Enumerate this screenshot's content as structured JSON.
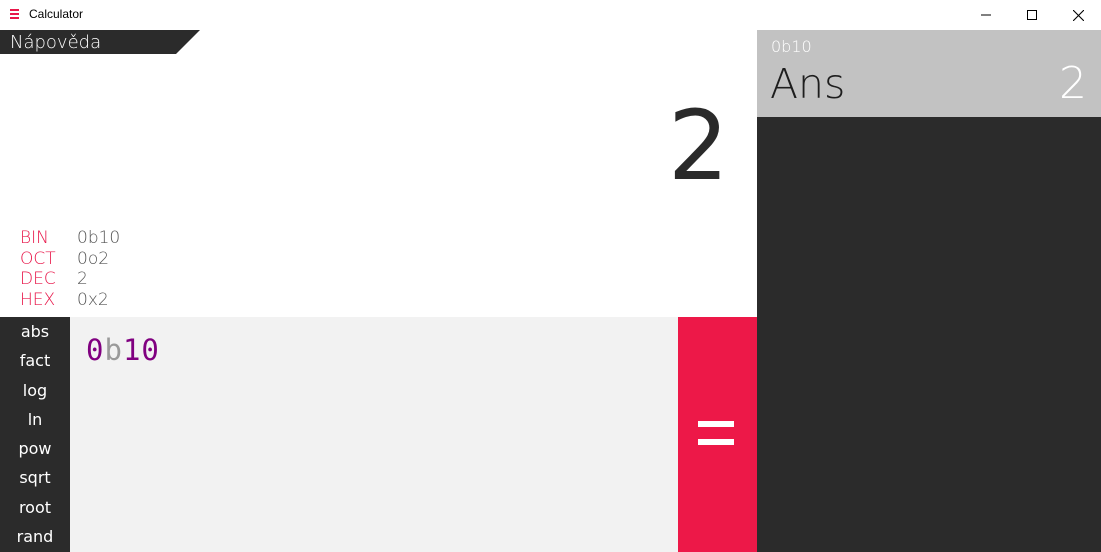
{
  "window": {
    "title": "Calculator",
    "icons": {
      "app": "calculator-icon",
      "minimize": "minimize-icon",
      "maximize": "maximize-icon",
      "close": "close-icon"
    }
  },
  "help": {
    "label": "Nápověda"
  },
  "result": {
    "value": "2"
  },
  "bases": [
    {
      "key": "BIN",
      "value": "0b10"
    },
    {
      "key": "OCT",
      "value": "0o2"
    },
    {
      "key": "DEC",
      "value": "2"
    },
    {
      "key": "HEX",
      "value": "0x2"
    }
  ],
  "functions": [
    "abs",
    "fact",
    "log",
    "ln",
    "pow",
    "sqrt",
    "root",
    "rand"
  ],
  "input": {
    "parts": [
      {
        "text": "0",
        "color": "#800080"
      },
      {
        "text": "b",
        "color": "#9a9a9a"
      },
      {
        "text": "10",
        "color": "#800080"
      }
    ]
  },
  "equals": {
    "icon": "equals-icon"
  },
  "history": [
    {
      "expression": "0b10",
      "name": "Ans",
      "value": "2"
    }
  ],
  "colors": {
    "accent": "#ed1848",
    "dark": "#2b2b2b",
    "history_entry_bg": "#c2c2c2",
    "input_bg": "#f2f2f2"
  }
}
